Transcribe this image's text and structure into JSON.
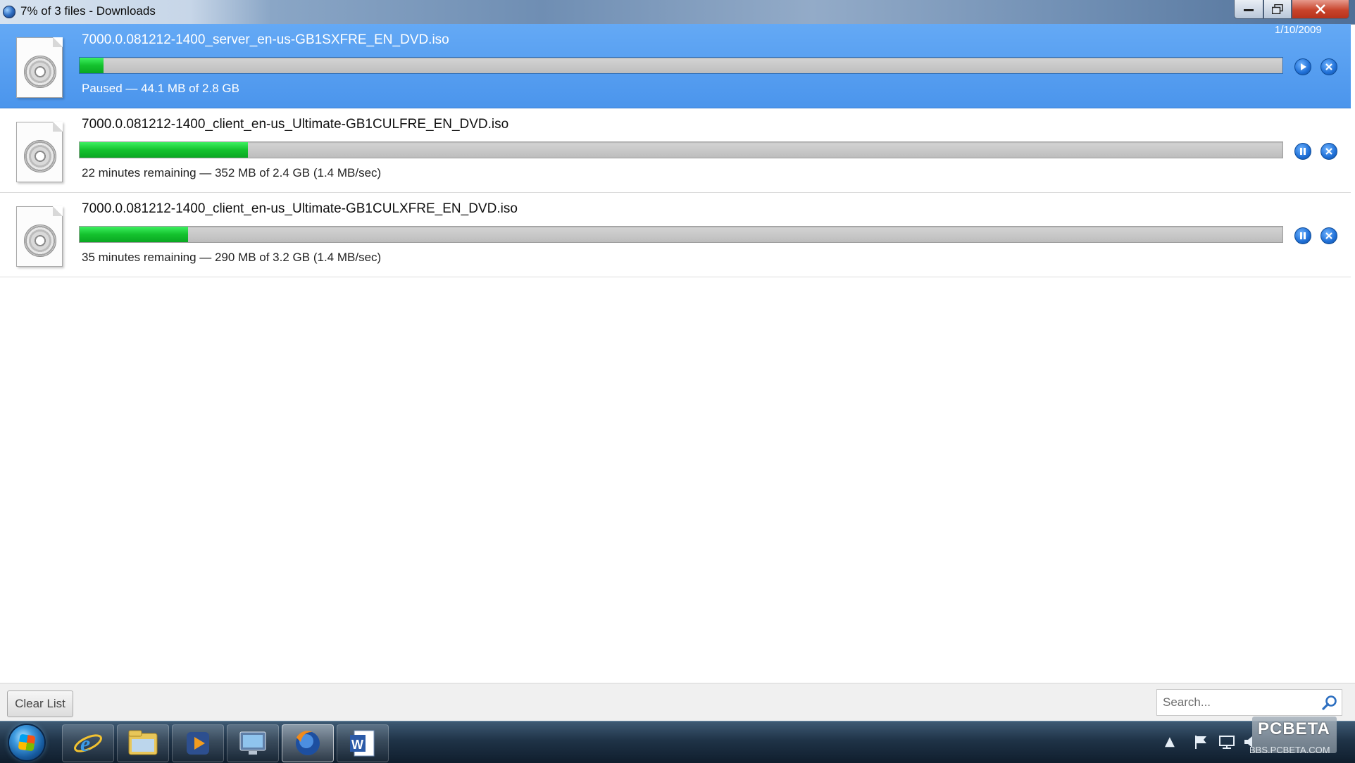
{
  "window": {
    "title": "7% of 3 files - Downloads"
  },
  "downloads": [
    {
      "filename": "7000.0.081212-1400_server_en-us-GB1SXFRE_EN_DVD.iso",
      "status": "Paused —  44.1 MB of 2.8 GB",
      "progress": 0.02,
      "state": "paused",
      "selected": true
    },
    {
      "filename": "7000.0.081212-1400_client_en-us_Ultimate-GB1CULFRE_EN_DVD.iso",
      "status": "22 minutes remaining — 352 MB of 2.4 GB (1.4 MB/sec)",
      "progress": 0.14,
      "state": "downloading",
      "selected": false
    },
    {
      "filename": "7000.0.081212-1400_client_en-us_Ultimate-GB1CULXFRE_EN_DVD.iso",
      "status": "35 minutes remaining — 290 MB of 3.2 GB (1.4 MB/sec)",
      "progress": 0.09,
      "state": "downloading",
      "selected": false
    }
  ],
  "toolbar": {
    "clear_list_label": "Clear List",
    "search_placeholder": "Search..."
  },
  "taskbar": {
    "apps": [
      "internet-explorer-icon",
      "windows-explorer-icon",
      "media-player-icon",
      "remote-desktop-icon",
      "firefox-icon",
      "word-icon"
    ],
    "active_app": "firefox-icon",
    "clock_time": "",
    "clock_date": "1/10/2009"
  },
  "watermark": {
    "text": "PCBETA",
    "sub": "BBS.PCBETA.COM"
  },
  "colors": {
    "selection": "#4b95ec",
    "progress_fill": "#14c22e",
    "progress_track": "#c8c8c8"
  }
}
